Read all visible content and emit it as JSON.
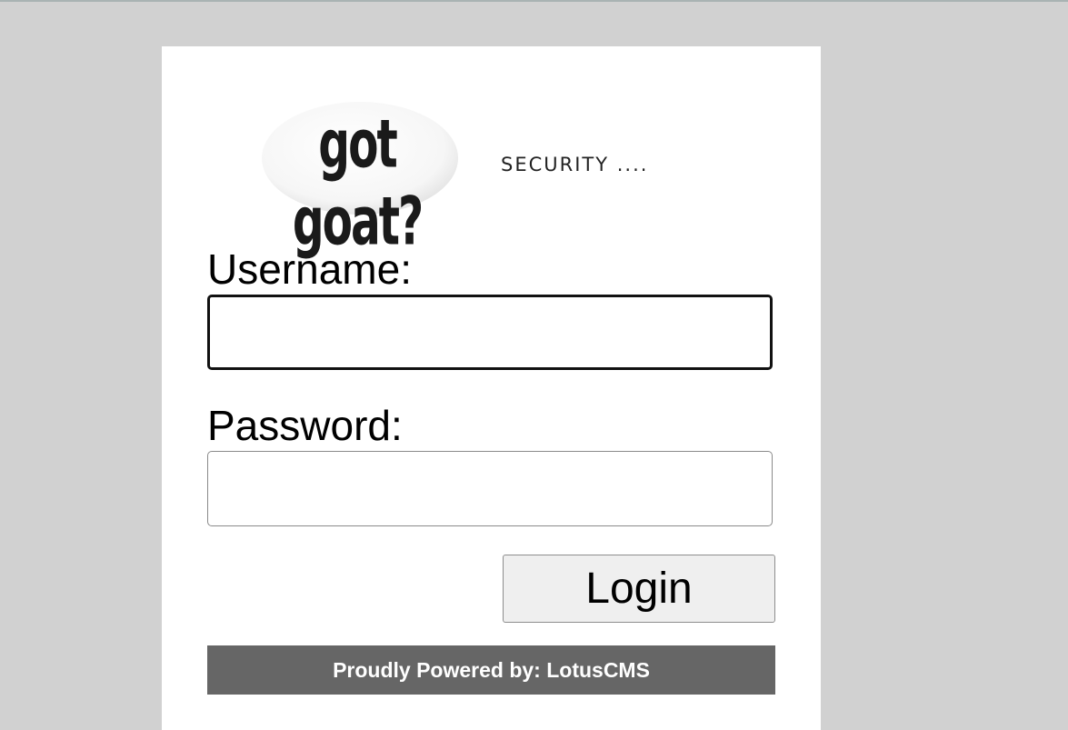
{
  "logo": {
    "text": "got goat?",
    "icon": "goat-ellipse-logo"
  },
  "header": {
    "tagline": "SECURITY ...."
  },
  "form": {
    "username_label": "Username:",
    "username_value": "",
    "password_label": "Password:",
    "password_value": "",
    "login_label": "Login"
  },
  "footer": {
    "text": "Proudly Powered by: LotusCMS"
  },
  "colors": {
    "background": "#d1d1d1",
    "panel": "#ffffff",
    "footer_bg": "#666666",
    "button_bg": "#efefef"
  }
}
